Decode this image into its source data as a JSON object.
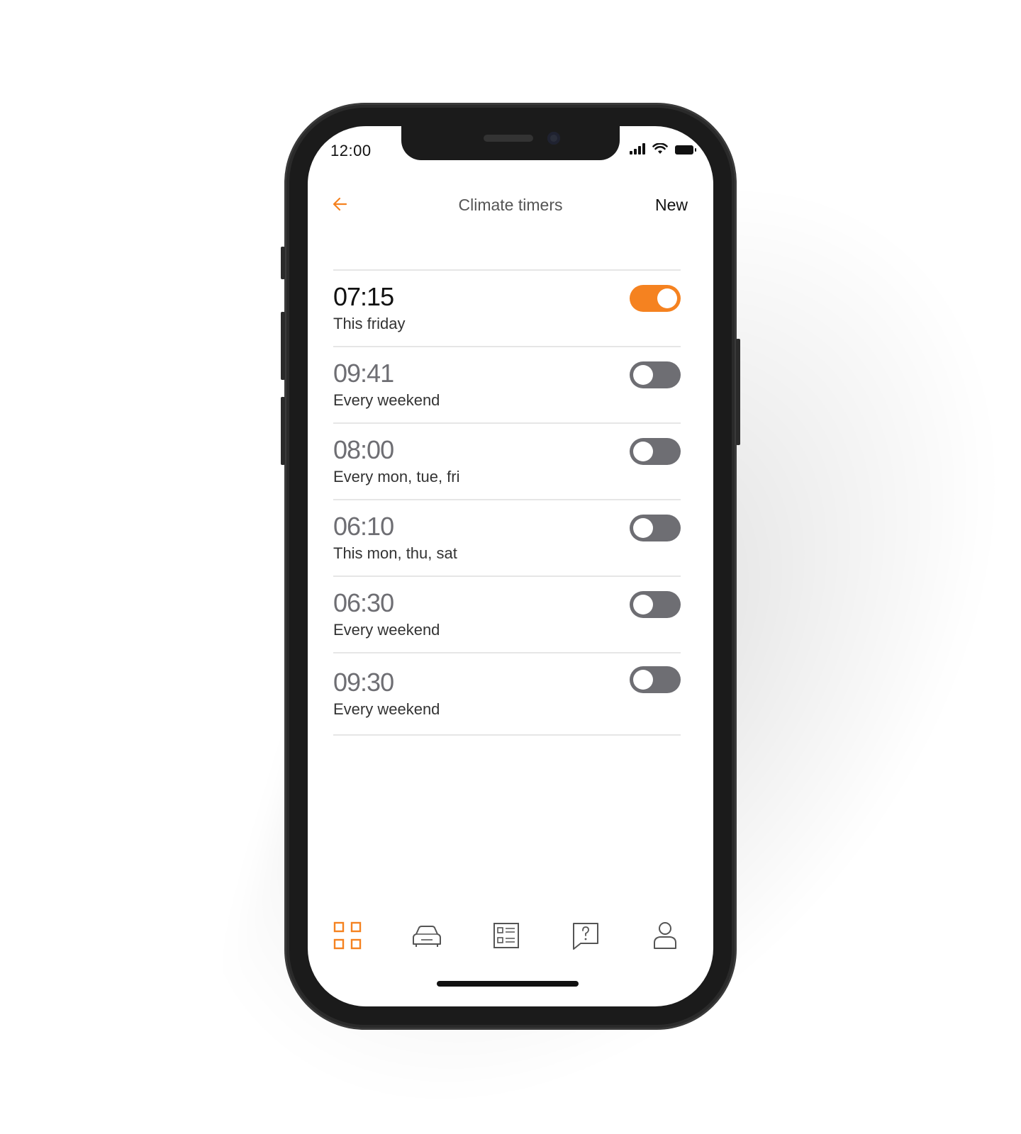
{
  "status_bar": {
    "time": "12:00"
  },
  "nav": {
    "title": "Climate timers",
    "new_label": "New"
  },
  "timers": [
    {
      "time": "07:15",
      "schedule": "This friday",
      "enabled": true
    },
    {
      "time": "09:41",
      "schedule": "Every weekend",
      "enabled": false
    },
    {
      "time": "08:00",
      "schedule": "Every mon, tue, fri",
      "enabled": false
    },
    {
      "time": "06:10",
      "schedule": "This mon, thu, sat",
      "enabled": false
    },
    {
      "time": "06:30",
      "schedule": "Every weekend",
      "enabled": false
    },
    {
      "time": "09:30",
      "schedule": "Every weekend",
      "enabled": false
    }
  ],
  "tab_bar": {
    "items": [
      {
        "icon": "dashboard-grid-icon",
        "active": true
      },
      {
        "icon": "car-icon",
        "active": false
      },
      {
        "icon": "list-icon",
        "active": false
      },
      {
        "icon": "help-chat-icon",
        "active": false
      },
      {
        "icon": "profile-icon",
        "active": false
      }
    ]
  },
  "colors": {
    "accent": "#f58220",
    "toggle_off": "#6e6e73",
    "divider": "#e6e6e6"
  }
}
